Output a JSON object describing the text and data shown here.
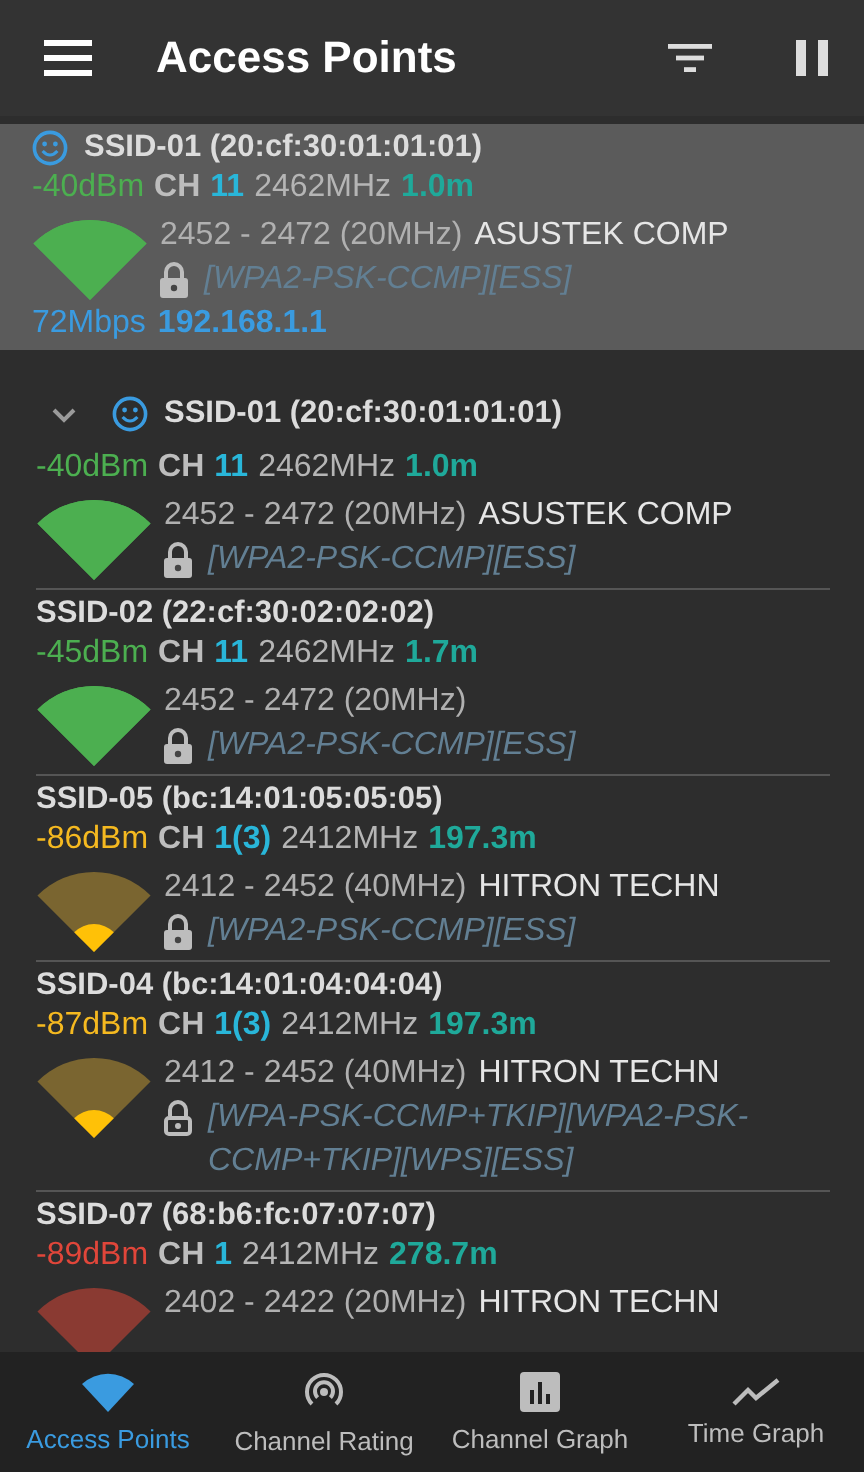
{
  "app_bar": {
    "title": "Access Points"
  },
  "connected": {
    "ssid": "SSID-01 (20:cf:30:01:01:01)",
    "connected": true,
    "kind": "strong",
    "rssi": "-40dBm",
    "ch_label": "CH",
    "channel": "11",
    "frequency": "2462MHz",
    "distance": "1.0m",
    "range": "2452 - 2472 (20MHz)",
    "vendor": "ASUSTEK COMP",
    "lock_outlined": false,
    "security": "[WPA2-PSK-CCMP][ESS]",
    "rate": "72Mbps",
    "ip": "192.168.1.1"
  },
  "access_points": [
    {
      "ssid": "SSID-01 (20:cf:30:01:01:01)",
      "expanded": true,
      "connected": true,
      "kind": "strong",
      "rssi": "-40dBm",
      "ch_label": "CH",
      "channel": "11",
      "frequency": "2462MHz",
      "distance": "1.0m",
      "range": "2452 - 2472 (20MHz)",
      "vendor": "ASUSTEK COMP",
      "lock_outlined": false,
      "security": "[WPA2-PSK-CCMP][ESS]"
    },
    {
      "ssid": "SSID-02 (22:cf:30:02:02:02)",
      "connected": false,
      "kind": "strong",
      "rssi": "-45dBm",
      "ch_label": "CH",
      "channel": "11",
      "frequency": "2462MHz",
      "distance": "1.7m",
      "range": "2452 - 2472 (20MHz)",
      "lock_outlined": false,
      "security": "[WPA2-PSK-CCMP][ESS]"
    },
    {
      "ssid": "SSID-05 (bc:14:01:05:05:05)",
      "connected": false,
      "kind": "weak",
      "rssi": "-86dBm",
      "ch_label": "CH",
      "channel": "1(3)",
      "frequency": "2412MHz",
      "distance": "197.3m",
      "range": "2412 - 2452 (40MHz)",
      "vendor": "HITRON TECHN",
      "lock_outlined": false,
      "security": "[WPA2-PSK-CCMP][ESS]"
    },
    {
      "ssid": "SSID-04 (bc:14:01:04:04:04)",
      "connected": false,
      "kind": "weak",
      "rssi": "-87dBm",
      "ch_label": "CH",
      "channel": "1(3)",
      "frequency": "2412MHz",
      "distance": "197.3m",
      "range": "2412 - 2452 (40MHz)",
      "vendor": "HITRON TECHN",
      "lock_outlined": true,
      "security": "[WPA-PSK-CCMP+TKIP][WPA2-PSK-CCMP+TKIP][WPS][ESS]"
    },
    {
      "ssid": "SSID-07 (68:b6:fc:07:07:07)",
      "connected": false,
      "kind": "poor",
      "rssi": "-89dBm",
      "ch_label": "CH",
      "channel": "1",
      "frequency": "2412MHz",
      "distance": "278.7m",
      "range": "2402 - 2422 (20MHz)",
      "vendor": "HITRON TECHN"
    }
  ],
  "bottom_nav": [
    {
      "kind": "wifi",
      "label": "Access Points",
      "selected": true
    },
    {
      "kind": "rating",
      "label": "Channel Rating",
      "selected": false
    },
    {
      "kind": "graph",
      "label": "Channel Graph",
      "selected": false
    },
    {
      "kind": "time",
      "label": "Time Graph",
      "selected": false
    }
  ]
}
